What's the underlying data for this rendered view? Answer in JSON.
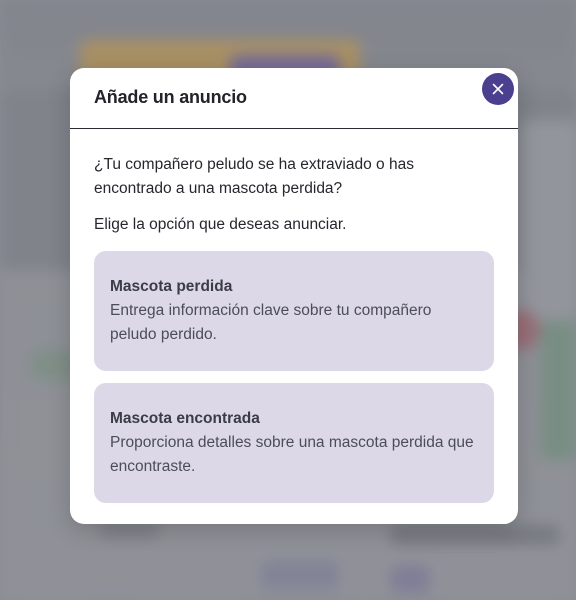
{
  "modal": {
    "title": "Añade un anuncio",
    "close_icon": "close-icon",
    "intro": "¿Tu compañero peludo se ha extraviado o has encontrado a una mascota perdida?",
    "prompt": "Elige la opción que deseas anunciar.",
    "options": [
      {
        "title": "Mascota perdida",
        "description": "Entrega información clave sobre tu compañero peludo perdido."
      },
      {
        "title": "Mascota encontrada",
        "description": "Proporciona detalles sobre una mascota perdida que encontraste."
      }
    ]
  },
  "colors": {
    "accent": "#4b3f8f",
    "option_background": "#dcd8e8",
    "overlay": "#9a9ca3"
  }
}
